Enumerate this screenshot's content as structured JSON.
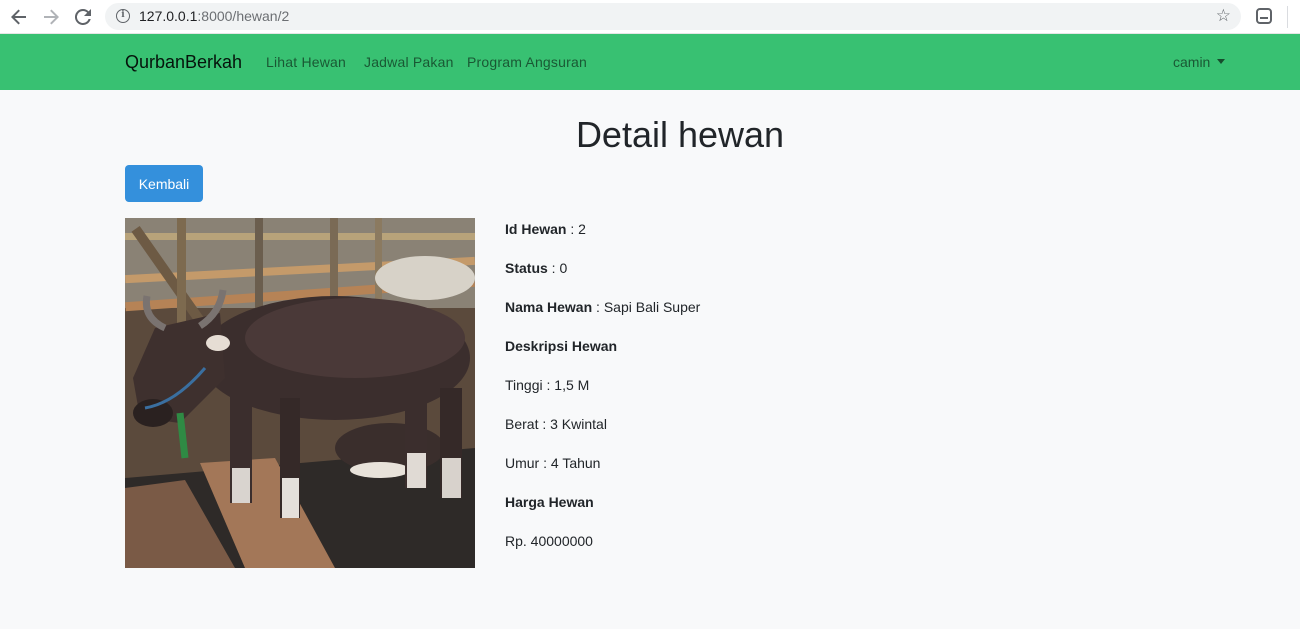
{
  "browser": {
    "url_host": "127.0.0.1",
    "url_rest": ":8000/hewan/2"
  },
  "navbar": {
    "brand": "QurbanBerkah",
    "links": [
      "Lihat Hewan",
      "Jadwal Pakan",
      "Program Angsuran"
    ],
    "user": "camin"
  },
  "page": {
    "title": "Detail hewan",
    "back_button": "Kembali"
  },
  "details": {
    "id_label": "Id Hewan",
    "id_value": " : 2",
    "status_label": "Status",
    "status_value": " : 0",
    "name_label": "Nama Hewan",
    "name_value": " : Sapi Bali Super",
    "desc_label": "Deskripsi Hewan",
    "height": "Tinggi : 1,5 M",
    "weight": "Berat : 3 Kwintal",
    "age": "Umur : 4 Tahun",
    "price_label": "Harga Hewan",
    "price_value": "Rp. 40000000"
  },
  "colors": {
    "navbar": "#38c172",
    "primary_button": "#3490dc",
    "background": "#f8f9fa"
  }
}
